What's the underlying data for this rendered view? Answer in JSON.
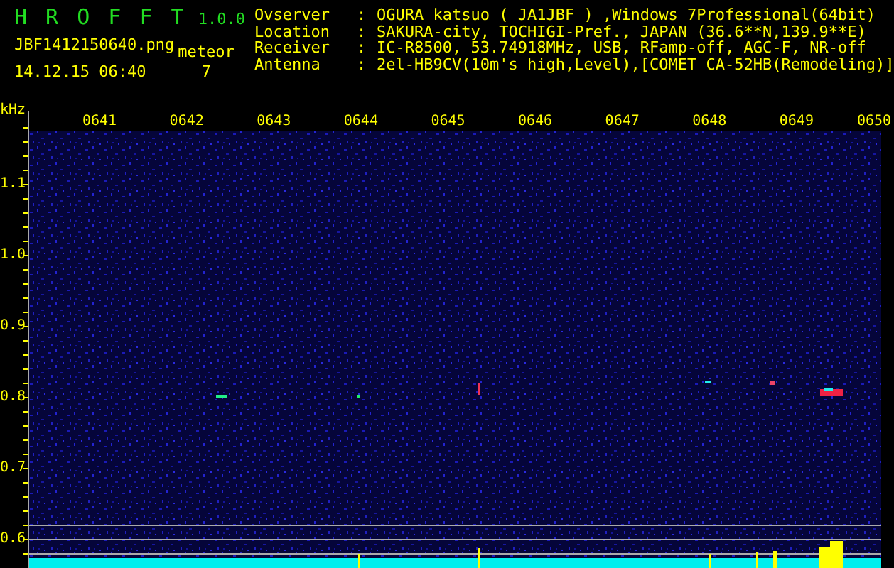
{
  "header": {
    "title": "H R O F F T",
    "version": "1.0.0",
    "filename": "JBF1412150640.png",
    "timestamp": "14.12.15 06:40",
    "meteor_label": "meteor",
    "meteor_count": "7"
  },
  "station_info": [
    {
      "label": "Ovserver",
      "separator": ":",
      "value": "OGURA katsuo ( JA1JBF ) ,Windows 7Professional(64bit)"
    },
    {
      "label": "Location",
      "separator": ":",
      "value": "SAKURA-city, TOCHIGI-Pref., JAPAN (36.6**N,139.9**E)"
    },
    {
      "label": "Receiver",
      "separator": ":",
      "value": "IC-R8500, 53.74918MHz, USB, RFamp-off, AGC-F, NR-off"
    },
    {
      "label": "Antenna",
      "separator": ":",
      "value": "2el-HB9CV(10m's high,Level),[COMET CA-52HB(Remodeling)]"
    }
  ],
  "spectrogram": {
    "y_unit": "kHz",
    "time_labels": [
      "0641",
      "0642",
      "0643",
      "0644",
      "0645",
      "0646",
      "0647",
      "0648",
      "0649",
      "0650"
    ],
    "freq_labels": [
      "1.1",
      "1.0",
      "0.9",
      "0.8",
      "0.7",
      "0.6"
    ]
  }
}
